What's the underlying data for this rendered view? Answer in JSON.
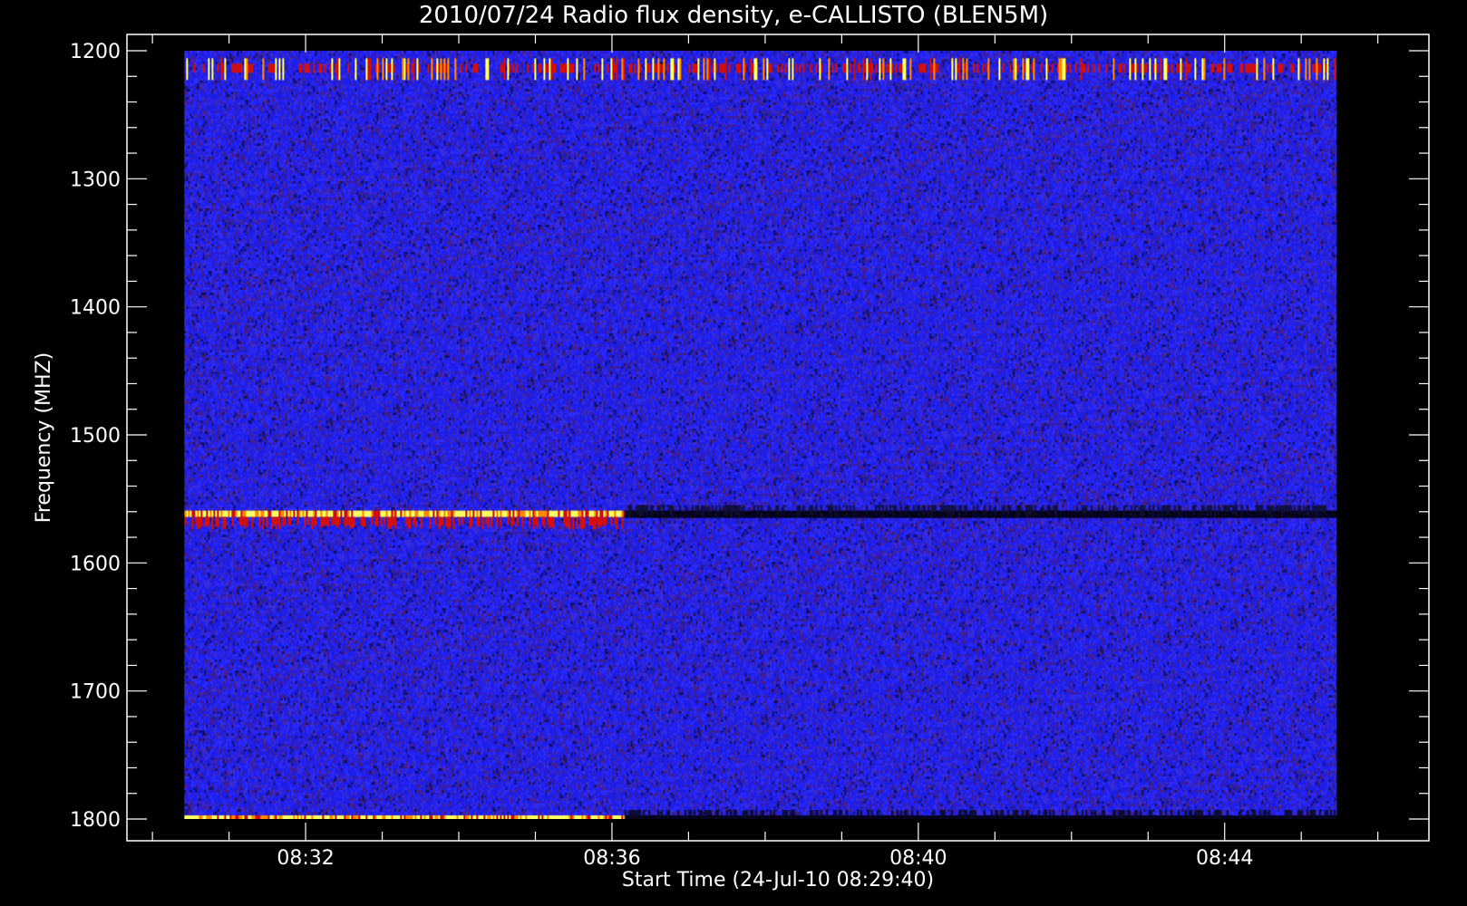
{
  "chart_data": {
    "type": "heatmap",
    "title": "2010/07/24  Radio flux density, e-CALLISTO (BLEN5M)",
    "xlabel": "Start Time (24-Jul-10 08:29:40)",
    "ylabel": "Frequency (MHZ)",
    "x_ticks": [
      "08:32",
      "08:36",
      "08:40",
      "08:44"
    ],
    "x_tick_minutes": [
      2.333,
      6.333,
      10.333,
      14.333
    ],
    "xlim_minutes": [
      0,
      17.0
    ],
    "data_xlim_minutes": [
      0.75,
      15.8
    ],
    "y_ticks": [
      1200,
      1300,
      1400,
      1500,
      1600,
      1700,
      1800
    ],
    "ylim": [
      1200,
      1800
    ],
    "y_inverted": true,
    "colormap": [
      "#000000",
      "#1a1aff",
      "#7a1a8a",
      "#d01010",
      "#ff8a00",
      "#ffff60"
    ],
    "background_color": "#000000",
    "noise_levels": [
      "#1e1ee6",
      "#2a2aff",
      "#3a2ad0",
      "#402090",
      "#10106a",
      "#501878",
      "#202080"
    ],
    "features": [
      {
        "freq_mhz": 1213,
        "t_start_min": 0.75,
        "t_end_min": 15.8,
        "intensity": "bright-intermittent",
        "colors": [
          "#ffff60",
          "#ff8a00",
          "#d01010"
        ]
      },
      {
        "freq_mhz": 1562,
        "t_start_min": 0.75,
        "t_end_min": 6.5,
        "intensity": "bright",
        "colors": [
          "#ffff60",
          "#ff8a00",
          "#d01010"
        ]
      },
      {
        "freq_mhz": 1562,
        "t_start_min": 6.5,
        "t_end_min": 15.8,
        "intensity": "dark",
        "colors": [
          "#000000",
          "#101030"
        ]
      },
      {
        "freq_mhz": 1800,
        "t_start_min": 0.75,
        "t_end_min": 6.5,
        "intensity": "bright",
        "colors": [
          "#ffff60",
          "#ff8a00",
          "#d01010"
        ]
      },
      {
        "freq_mhz": 1800,
        "t_start_min": 6.5,
        "t_end_min": 15.8,
        "intensity": "dark",
        "colors": [
          "#000000",
          "#0a0a20"
        ]
      }
    ]
  }
}
